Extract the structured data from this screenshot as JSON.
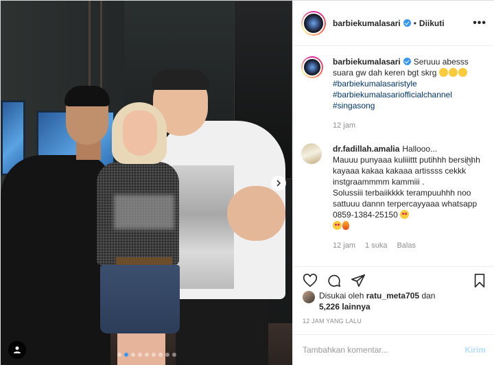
{
  "post": {
    "username": "barbiekumalasari",
    "follow_separator": "•",
    "follow_status": "Diikuti",
    "more_label": "•••",
    "caption": {
      "username": "barbiekumalasari",
      "text": "Seruuu abesss suara gw dah keren bgt skrg",
      "emoji": [
        "rofl",
        "rofl",
        "rofl"
      ],
      "hashtags": [
        "#barbiekumalasaristyle",
        "#barbiekumalasariofficialchannel",
        "#singasong"
      ],
      "time": "12 jam"
    },
    "comments": [
      {
        "username": "dr.fadillah.amalia",
        "lines": [
          "Hallooo...",
          "Mauuu punyaaa kuliiittt putihhh bersihhh kayaaa kakaa kakaaa artissss cekkk instgraammmm kammiii .",
          "Solussiii terbaiikkkk terampuuhhh noo sattuuu dannn terpercayyaaa whatsapp 0859-1384-25150"
        ],
        "time": "12 jam",
        "likes": "1 suka",
        "reply": "Balas"
      }
    ],
    "likes_summary": {
      "prefix": "Disukai oleh",
      "user": "ratu_meta705",
      "joiner": "dan",
      "count": "5,226 lainnya"
    },
    "timestamp": "12 JAM YANG LALU",
    "composer": {
      "placeholder": "Tambahkan komentar...",
      "post_label": "Kirim"
    },
    "carousel": {
      "dots": 9,
      "active_index": 1
    }
  },
  "colors": {
    "accent": "#3897f0",
    "hashtag": "#003569",
    "muted": "#8e8e8e",
    "post_disabled": "#b2dffc"
  },
  "icons": [
    "verified-badge-icon",
    "more-options-icon",
    "heart-icon",
    "comment-icon",
    "share-icon",
    "bookmark-icon",
    "chevron-right-icon",
    "user-tag-icon"
  ]
}
